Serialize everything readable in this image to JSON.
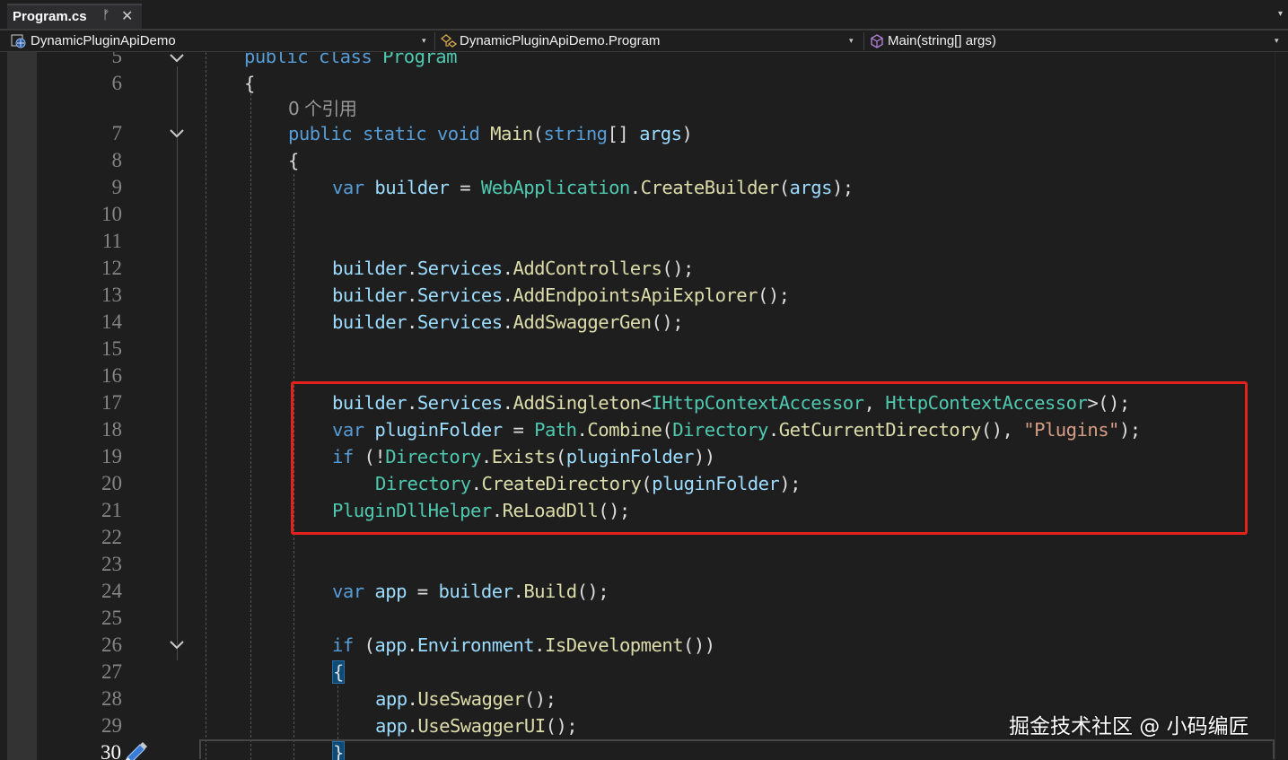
{
  "tab": {
    "title": "Program.cs",
    "pin_glyph": "ᚠ",
    "close_glyph": "✕",
    "pin_icon": "pin-icon",
    "close_icon": "close-icon"
  },
  "navbar": {
    "project": "DynamicPluginApiDemo",
    "type": "DynamicPluginApiDemo.Program",
    "member": "Main(string[] args)",
    "caret": "▾"
  },
  "lines": {
    "l5": {
      "no": "5"
    },
    "l6": {
      "no": "6"
    },
    "lref": {
      "text": "0 个引用"
    },
    "l7": {
      "no": "7"
    },
    "l8": {
      "no": "8"
    },
    "l9": {
      "no": "9"
    },
    "l10": {
      "no": "10"
    },
    "l11": {
      "no": "11"
    },
    "l12": {
      "no": "12"
    },
    "l13": {
      "no": "13"
    },
    "l14": {
      "no": "14"
    },
    "l15": {
      "no": "15"
    },
    "l16": {
      "no": "16"
    },
    "l17": {
      "no": "17"
    },
    "l18": {
      "no": "18"
    },
    "l19": {
      "no": "19"
    },
    "l20": {
      "no": "20"
    },
    "l21": {
      "no": "21"
    },
    "l22": {
      "no": "22"
    },
    "l23": {
      "no": "23"
    },
    "l24": {
      "no": "24"
    },
    "l25": {
      "no": "25"
    },
    "l26": {
      "no": "26"
    },
    "l27": {
      "no": "27"
    },
    "l28": {
      "no": "28"
    },
    "l29": {
      "no": "29"
    },
    "l30": {
      "no": "30"
    }
  },
  "tokens": {
    "public": "public",
    "class": "class",
    "Program": "Program",
    "static": "static",
    "void": "void",
    "Main": "Main",
    "string": "string",
    "args": "args",
    "var": "var",
    "builder": "builder",
    "WebApplication": "WebApplication",
    "CreateBuilder": "CreateBuilder",
    "Services": "Services",
    "AddControllers": "AddControllers",
    "AddEndpointsApiExplorer": "AddEndpointsApiExplorer",
    "AddSwaggerGen": "AddSwaggerGen",
    "AddSingleton": "AddSingleton",
    "IHttpContextAccessor": "IHttpContextAccessor",
    "HttpContextAccessor": "HttpContextAccessor",
    "pluginFolder": "pluginFolder",
    "Path": "Path",
    "Combine": "Combine",
    "Directory": "Directory",
    "GetCurrentDirectory": "GetCurrentDirectory",
    "Plugins": "\"Plugins\"",
    "if": "if",
    "Exists": "Exists",
    "CreateDirectory": "CreateDirectory",
    "PluginDllHelper": "PluginDllHelper",
    "ReLoadDll": "ReLoadDll",
    "app": "app",
    "Build": "Build",
    "Environment": "Environment",
    "IsDevelopment": "IsDevelopment",
    "UseSwagger": "UseSwagger",
    "UseSwaggerUI": "UseSwaggerUI"
  },
  "icons": {
    "fold": "chevron-down-icon",
    "project": "csharp-project-icon",
    "class": "class-icon",
    "method": "method-icon",
    "edit": "pencil-icon"
  },
  "watermark": "掘金技术社区 @ 小码编匠",
  "colors": {
    "keyword": "#569cd6",
    "type": "#4ec9b0",
    "method": "#dcdcaa",
    "identifier": "#9cdcfe",
    "string": "#d69d85",
    "highlight": "#e3231b",
    "background": "#1e1e1e"
  }
}
